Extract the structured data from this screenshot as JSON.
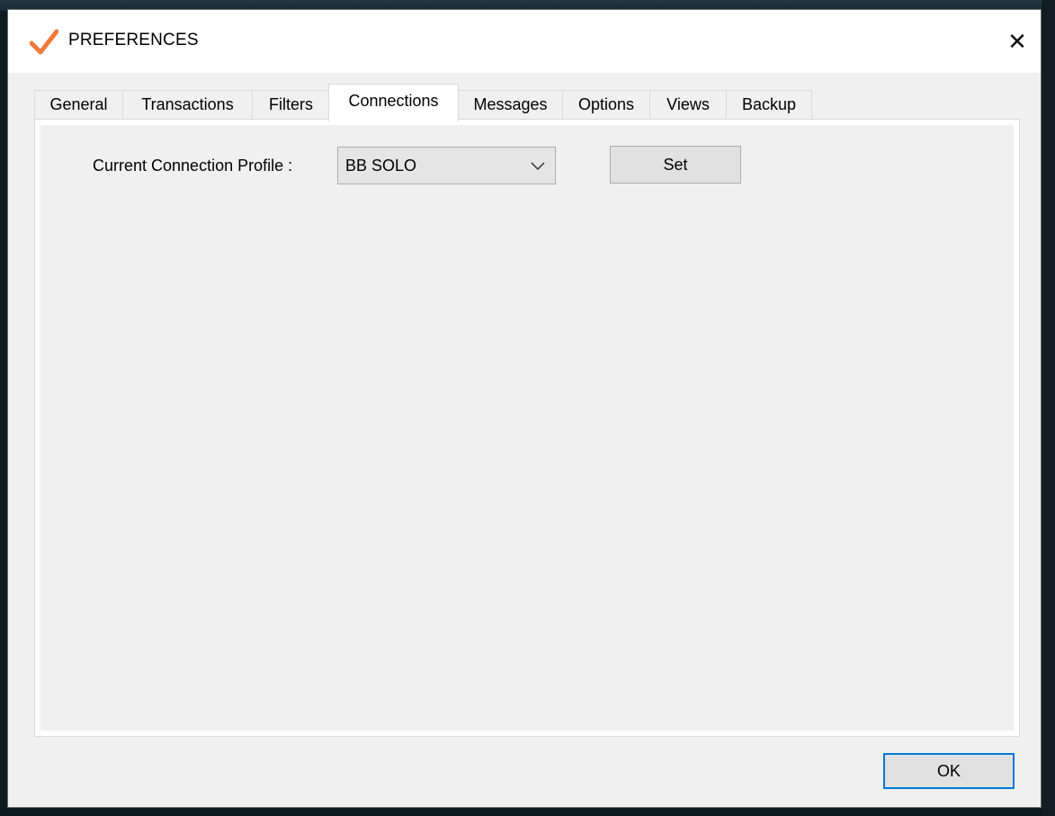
{
  "window": {
    "title": "PREFERENCES",
    "close_glyph": "✕",
    "app_icon": "checkmark-icon",
    "accent_color": "#f07a3a"
  },
  "tabs": [
    {
      "label": "General",
      "active": false
    },
    {
      "label": "Transactions",
      "active": false
    },
    {
      "label": "Filters",
      "active": false
    },
    {
      "label": "Connections",
      "active": true
    },
    {
      "label": "Messages",
      "active": false
    },
    {
      "label": "Options",
      "active": false
    },
    {
      "label": "Views",
      "active": false
    },
    {
      "label": "Backup",
      "active": false
    }
  ],
  "connections": {
    "profile_label": "Current Connection Profile :",
    "profile_value": "BB SOLO",
    "set_label": "Set"
  },
  "footer": {
    "ok_label": "OK",
    "ok_focus_color": "#0078d7"
  }
}
